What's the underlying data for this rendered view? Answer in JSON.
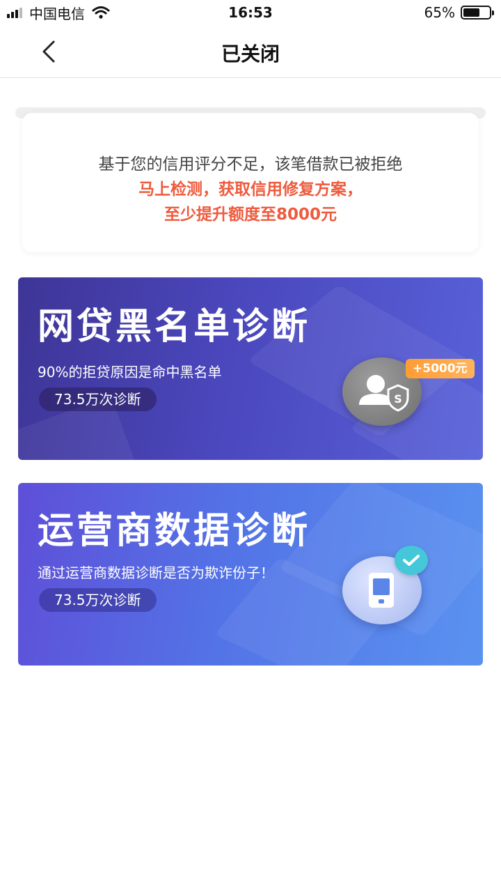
{
  "status_bar": {
    "carrier": "中国电信",
    "time": "16:53",
    "battery_percent": "65%",
    "battery_level": 0.65,
    "signal_bars": 3
  },
  "nav": {
    "title": "已关闭",
    "back_icon": "chevron-left-icon"
  },
  "notice": {
    "line1": "基于您的信用评分不足，该笔借款已被拒绝",
    "line2": "马上检测，获取信用修复方案，",
    "line3": "至少提升额度至8000元",
    "highlight_color": "#ee5a3d"
  },
  "cards": [
    {
      "title": "网贷黑名单诊断",
      "subtitle": "90%的拒贷原因是命中黑名单",
      "count_label": "73.5万次诊断",
      "badge": "+5000元",
      "icon": "user-shield-icon",
      "bg_colors": [
        "#3e3596",
        "#5861d9"
      ]
    },
    {
      "title": "运营商数据诊断",
      "subtitle": "通过运营商数据诊断是否为欺诈份子！",
      "count_label": "73.5万次诊断",
      "icon": "phone-check-icon",
      "bg_colors": [
        "#5e4fd8",
        "#5a92f0"
      ]
    }
  ]
}
